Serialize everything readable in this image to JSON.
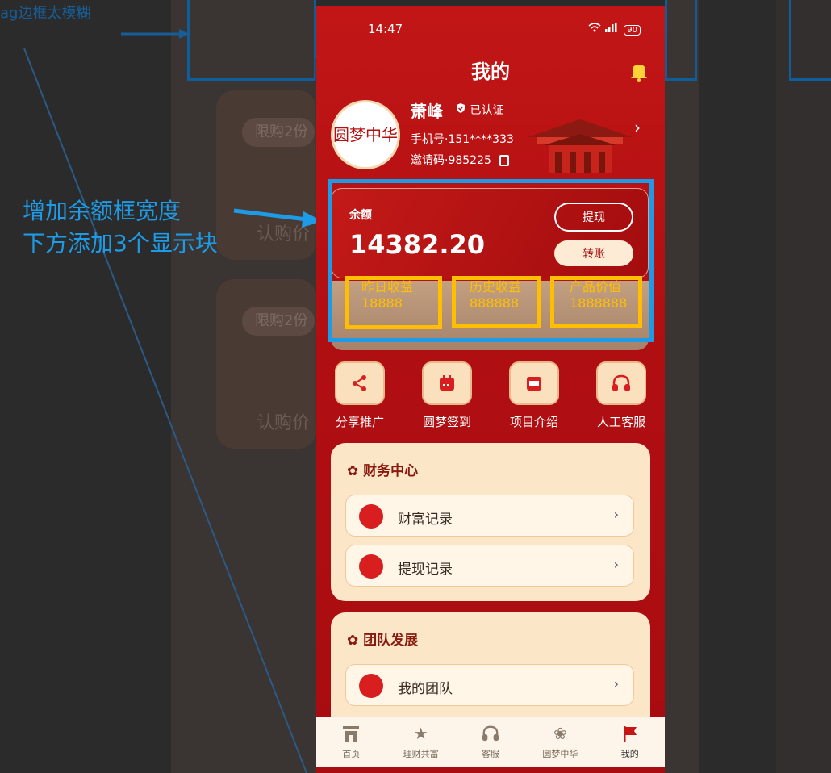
{
  "background": {
    "note": "ag边框太模糊",
    "ghost_tag_1": "限购2份",
    "ghost_text_1": "认购价",
    "ghost_tag_2": "限购2份",
    "ghost_text_2": "认购价"
  },
  "annotation": {
    "line1": "增加余额框宽度",
    "line2": "下方添加3个显示块"
  },
  "status_bar": {
    "time": "14:47",
    "battery": "90"
  },
  "header": {
    "title": "我的"
  },
  "profile": {
    "name": "萧峰",
    "verified": "已认证",
    "phone": "手机号·151****333",
    "invite": "邀请码·985225",
    "avatar_text": "圆梦中华"
  },
  "balance": {
    "label": "余额",
    "value": "14382.20",
    "withdraw_label": "提现",
    "transfer_label": "转账"
  },
  "stats": [
    {
      "label": "昨日收益",
      "value": "18888"
    },
    {
      "label": "历史收益",
      "value": "888888"
    },
    {
      "label": "产品价值",
      "value": "1888888"
    }
  ],
  "quick_actions": [
    {
      "label": "分享推广",
      "icon": "share-icon"
    },
    {
      "label": "圆梦签到",
      "icon": "calendar-icon"
    },
    {
      "label": "项目介绍",
      "icon": "ppt-icon"
    },
    {
      "label": "人工客服",
      "icon": "headset-icon"
    }
  ],
  "finance_center": {
    "title": "财务中心",
    "items": [
      {
        "label": "财富记录",
        "icon": "wealth-record-icon"
      },
      {
        "label": "提现记录",
        "icon": "withdraw-record-icon"
      }
    ]
  },
  "team_development": {
    "title": "团队发展",
    "items": [
      {
        "label": "我的团队",
        "icon": "team-icon"
      }
    ]
  },
  "tabbar": [
    {
      "label": "首页",
      "icon": "home-icon"
    },
    {
      "label": "理财共富",
      "icon": "stars-icon"
    },
    {
      "label": "客服",
      "icon": "headset-icon"
    },
    {
      "label": "圆梦中华",
      "icon": "flower-icon"
    },
    {
      "label": "我的",
      "icon": "flag-icon"
    }
  ],
  "colors": {
    "primary_red": "#b10f12",
    "annotation_blue": "#1d9be6",
    "highlight_yellow": "#ffbf00",
    "card_cream": "#fbe6c8"
  }
}
